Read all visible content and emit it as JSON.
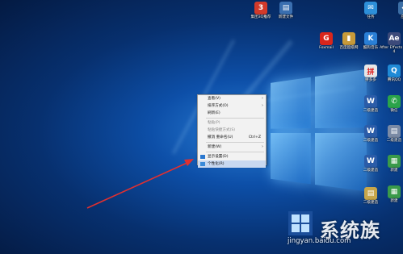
{
  "desktop_icons": [
    {
      "id": "icon-3q",
      "label": "集团3Q推荐",
      "glyph": "3",
      "bg": "#d23a2a"
    },
    {
      "id": "icon-sheet",
      "label": "新建文件",
      "glyph": "▤",
      "bg": "#3a6fb0"
    },
    {
      "id": "icon-renwu",
      "label": "任务",
      "glyph": "✉",
      "bg": "#2d8fd9"
    },
    {
      "id": "icon-app1",
      "label": "应用",
      "glyph": "◆",
      "bg": "#3b6ea5"
    },
    {
      "id": "icon-foxmail",
      "label": "Foxmail",
      "glyph": "G",
      "bg": "#d9261c"
    },
    {
      "id": "icon-baidu",
      "label": "百度超级网",
      "glyph": "▮",
      "bg": "#c79a3a"
    },
    {
      "id": "icon-kugou",
      "label": "酷狗音乐",
      "glyph": "K",
      "bg": "#2a7fd6"
    },
    {
      "id": "icon-ae",
      "label": "After Effects CS4",
      "glyph": "Ae",
      "bg": "#3c4a7a"
    },
    {
      "id": "icon-pdd",
      "label": "拼多多",
      "glyph": "拼",
      "bg": "#e8e8e8"
    },
    {
      "id": "icon-qq",
      "label": "腾讯QQ",
      "glyph": "Q",
      "bg": "#1f8ad6"
    },
    {
      "id": "icon-word1",
      "label": "二级建造",
      "glyph": "W",
      "bg": "#2b5ca8"
    },
    {
      "id": "icon-wechat",
      "label": "微信",
      "glyph": "✆",
      "bg": "#2aa34a"
    },
    {
      "id": "icon-word2",
      "label": "二级建造",
      "glyph": "W",
      "bg": "#2b5ca8"
    },
    {
      "id": "icon-file3",
      "label": "二级建造",
      "glyph": "▤",
      "bg": "#7a8aa5"
    },
    {
      "id": "icon-green1",
      "label": "新建",
      "glyph": "▦",
      "bg": "#3a9a4a"
    },
    {
      "id": "icon-word3",
      "label": "二级建造",
      "glyph": "W",
      "bg": "#2b5ca8"
    },
    {
      "id": "icon-green2",
      "label": "新建",
      "glyph": "▦",
      "bg": "#3a9a4a"
    },
    {
      "id": "icon-file4",
      "label": "二级建造",
      "glyph": "▤",
      "bg": "#c7a64a"
    }
  ],
  "context_menu": {
    "items": [
      {
        "label": "查看(V)",
        "sub": true,
        "disabled": false
      },
      {
        "label": "排序方式(O)",
        "sub": true,
        "disabled": false
      },
      {
        "label": "刷新(E)",
        "sub": false,
        "disabled": false
      },
      {
        "sep": true
      },
      {
        "label": "粘贴(P)",
        "sub": false,
        "disabled": true
      },
      {
        "label": "粘贴快捷方式(S)",
        "sub": false,
        "disabled": true
      },
      {
        "label": "撤消 重命名(U)",
        "shortcut": "Ctrl+Z",
        "sub": false,
        "disabled": false
      },
      {
        "sep": true
      },
      {
        "label": "新建(W)",
        "sub": true,
        "disabled": false
      },
      {
        "sep": true
      },
      {
        "label": "显示设置(D)",
        "sub": false,
        "disabled": false,
        "icon": "display-icon"
      },
      {
        "label": "个性化(R)",
        "sub": false,
        "disabled": false,
        "icon": "personalize-icon",
        "highlight": true
      }
    ]
  },
  "watermark": {
    "title": "系统族",
    "url": "jingyan.baidu.com"
  },
  "colors": {
    "arrow": "#e03030",
    "menu_bg": "#f2f2f2"
  }
}
